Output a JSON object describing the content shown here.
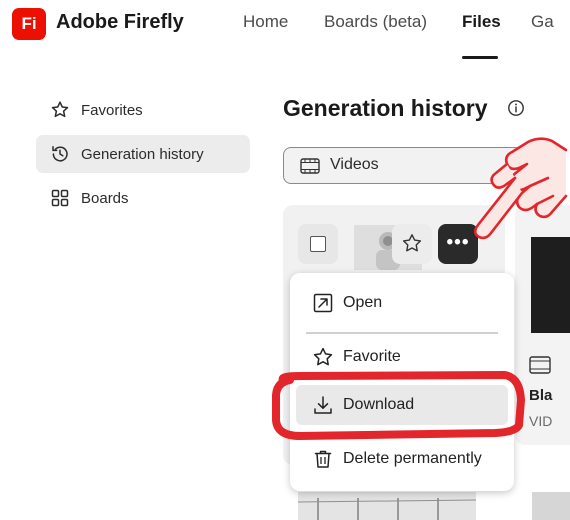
{
  "app": {
    "logo_text": "Fi",
    "title": "Adobe Firefly",
    "brand_color": "#eb1000"
  },
  "nav": {
    "items": [
      {
        "label": "Home"
      },
      {
        "label": "Boards (beta)"
      },
      {
        "label": "Files"
      },
      {
        "label": "Ga"
      }
    ],
    "active": "Files"
  },
  "sidebar": {
    "items": [
      {
        "label": "Favorites",
        "icon": "star-outline-icon"
      },
      {
        "label": "Generation history",
        "icon": "history-icon"
      },
      {
        "label": "Boards",
        "icon": "boards-icon"
      }
    ],
    "active": "Generation history"
  },
  "main": {
    "title": "Generation history",
    "filter_label": "Videos"
  },
  "cards": [
    {
      "name": "",
      "type": ""
    },
    {
      "name": "Bla",
      "type": "VID"
    }
  ],
  "context_menu": {
    "items": [
      {
        "label": "Open",
        "icon": "open-external-icon"
      },
      {
        "label": "Favorite",
        "icon": "star-outline-icon"
      },
      {
        "label": "Download",
        "icon": "download-icon",
        "highlighted": true
      },
      {
        "label": "Delete permanently",
        "icon": "trash-icon"
      }
    ]
  },
  "annotation": {
    "color": "#e3262b"
  }
}
